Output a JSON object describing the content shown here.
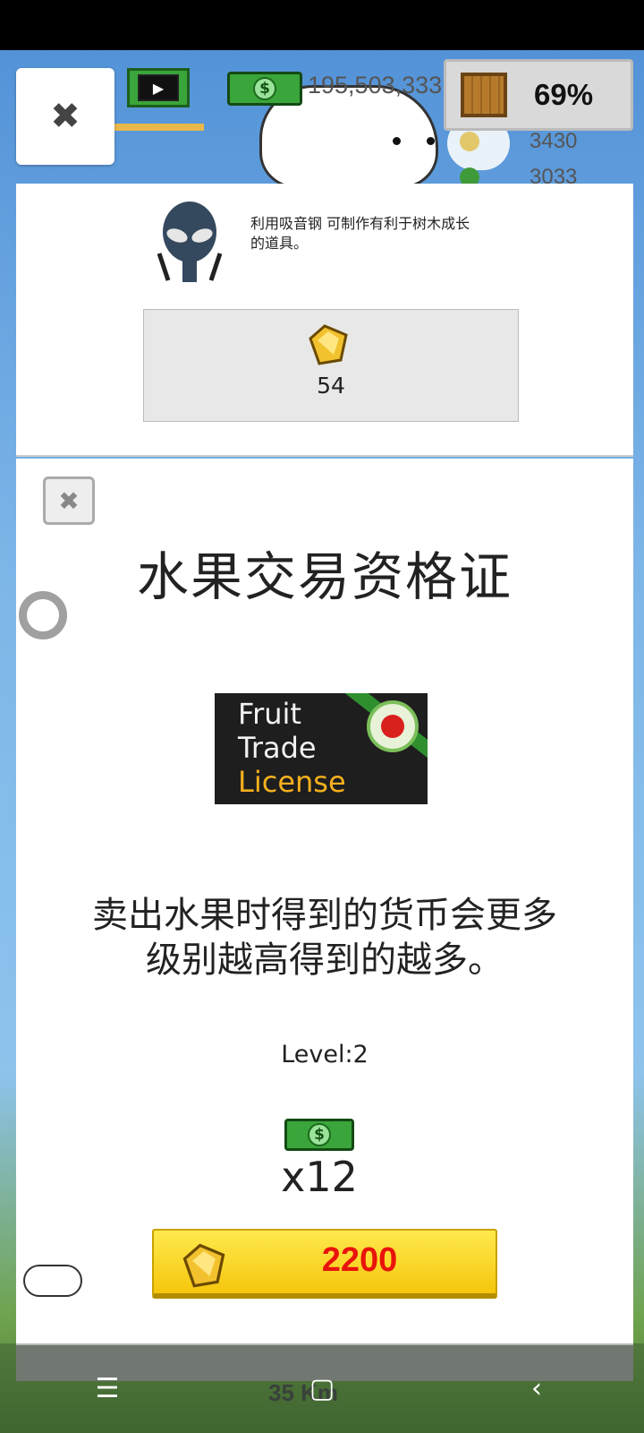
{
  "hud": {
    "money": "195,503,333",
    "storage_percent": "69%",
    "side_counts": [
      "3430",
      "3033"
    ],
    "distance": "35 Km"
  },
  "info_panel": {
    "description": "利用吸音钢 可制作有利于树木成长的道具。",
    "gem_count": "54"
  },
  "license": {
    "title": "水果交易资格证",
    "badge_line1": "Fruit",
    "badge_line2": "Trade",
    "badge_line3": "License",
    "description_line1": "卖出水果时得到的货币会更多",
    "description_line2": "级别越高得到的越多。",
    "level": "Level:2",
    "multiplier": "x12",
    "price": "2200"
  },
  "icons": {
    "close": "✖",
    "money_symbol": "$",
    "nav_menu": "☰",
    "nav_home": "▢",
    "nav_back": "‹"
  },
  "colors": {
    "gold_button": "#f5c60d",
    "price_red": "#e8140c",
    "money_green": "#3aa53a",
    "license_orange": "#f5b01d"
  }
}
